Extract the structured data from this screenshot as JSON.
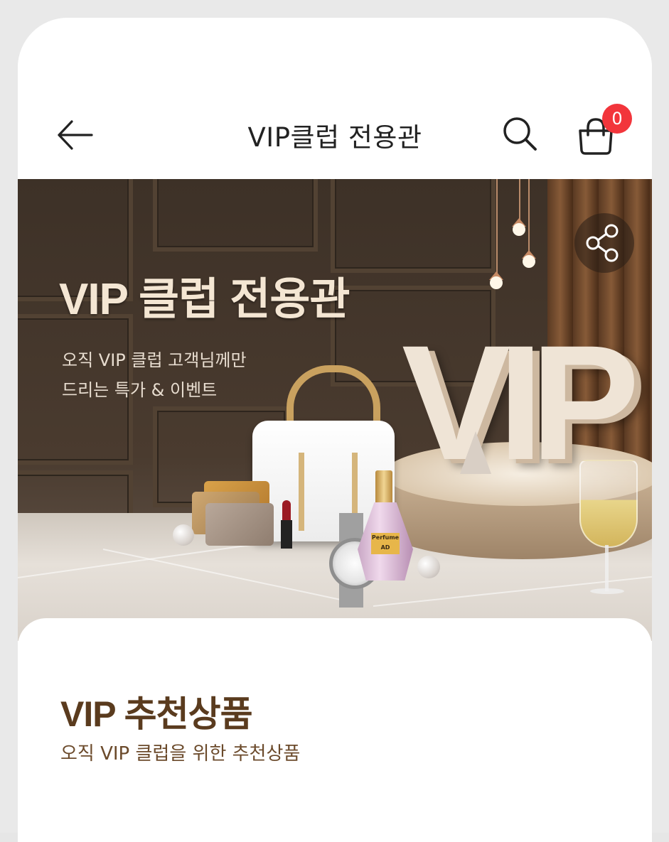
{
  "header": {
    "title": "VIP클럽 전용관",
    "cart_count": "0"
  },
  "banner": {
    "title": "VIP 클럽 전용관",
    "subtitle_line1": "오직 VIP 클럽 고객님께만",
    "subtitle_line2": "드리는 특가 & 이벤트",
    "decor_letters": "VIP",
    "perfume_label": "Perfume AD"
  },
  "section": {
    "title": "VIP 추천상품",
    "subtitle": "오직 VIP 클럽을 위한 추천상품"
  },
  "colors": {
    "badge": "#f2353b",
    "section_title": "#5a3b1e",
    "banner_text": "#f4e6d3"
  },
  "icons": {
    "back": "arrow-left-icon",
    "search": "search-icon",
    "cart": "shopping-bag-icon",
    "share": "share-icon"
  }
}
